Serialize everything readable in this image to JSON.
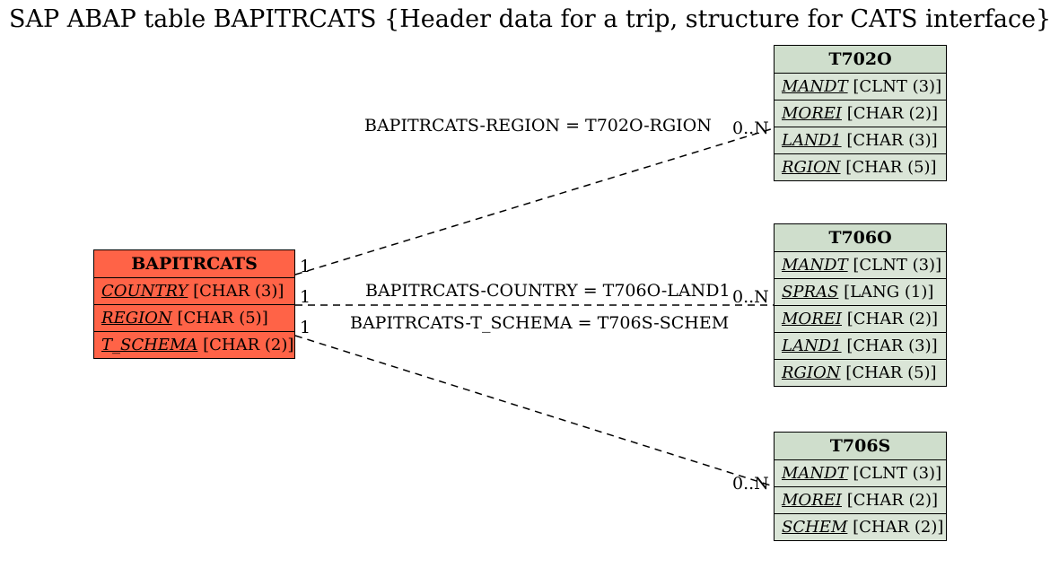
{
  "title": "SAP ABAP table BAPITRCATS {Header data for a trip, structure for CATS interface}",
  "entities": {
    "source": {
      "name": "BAPITRCATS",
      "fields": [
        {
          "name": "COUNTRY",
          "type": "[CHAR (3)]"
        },
        {
          "name": "REGION",
          "type": "[CHAR (5)]"
        },
        {
          "name": "T_SCHEMA",
          "type": "[CHAR (2)]"
        }
      ]
    },
    "t702o": {
      "name": "T702O",
      "fields": [
        {
          "name": "MANDT",
          "type": "[CLNT (3)]"
        },
        {
          "name": "MOREI",
          "type": "[CHAR (2)]"
        },
        {
          "name": "LAND1",
          "type": "[CHAR (3)]"
        },
        {
          "name": "RGION",
          "type": "[CHAR (5)]"
        }
      ]
    },
    "t706o": {
      "name": "T706O",
      "fields": [
        {
          "name": "MANDT",
          "type": "[CLNT (3)]"
        },
        {
          "name": "SPRAS",
          "type": "[LANG (1)]"
        },
        {
          "name": "MOREI",
          "type": "[CHAR (2)]"
        },
        {
          "name": "LAND1",
          "type": "[CHAR (3)]"
        },
        {
          "name": "RGION",
          "type": "[CHAR (5)]"
        }
      ]
    },
    "t706s": {
      "name": "T706S",
      "fields": [
        {
          "name": "MANDT",
          "type": "[CLNT (3)]"
        },
        {
          "name": "MOREI",
          "type": "[CHAR (2)]"
        },
        {
          "name": "SCHEM",
          "type": "[CHAR (2)]"
        }
      ]
    }
  },
  "relations": [
    {
      "label": "BAPITRCATS-REGION = T702O-RGION",
      "src_card": "1",
      "tgt_card": "0..N"
    },
    {
      "label": "BAPITRCATS-COUNTRY = T706O-LAND1",
      "src_card": "1",
      "tgt_card": "0..N"
    },
    {
      "label": "BAPITRCATS-T_SCHEMA = T706S-SCHEM",
      "src_card": "1",
      "tgt_card": "0..N"
    }
  ]
}
